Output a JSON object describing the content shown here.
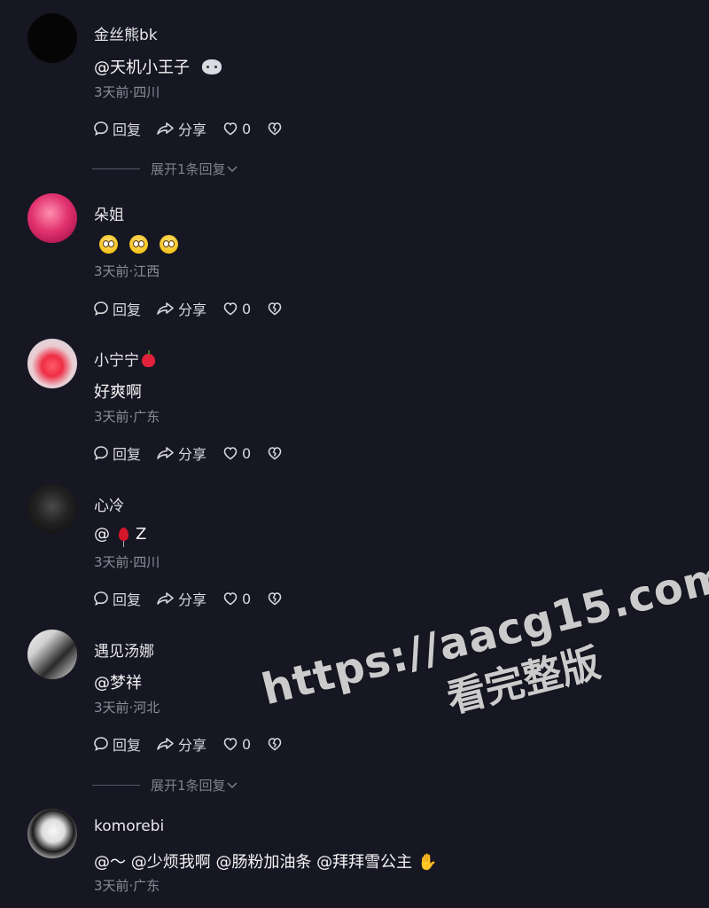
{
  "comments": [
    {
      "name": "金丝熊bk",
      "content": "@天机小王子",
      "meta": "3天前·四川",
      "reply": "回复",
      "share": "分享",
      "likes": "0",
      "expand": "展开1条回复"
    },
    {
      "name": "朵姐",
      "content": "",
      "meta": "3天前·江西",
      "reply": "回复",
      "share": "分享",
      "likes": "0"
    },
    {
      "name": "小宁宁",
      "content": "好爽啊",
      "meta": "3天前·广东",
      "reply": "回复",
      "share": "分享",
      "likes": "0"
    },
    {
      "name": "心冷",
      "content_prefix": "@",
      "content_suffix": "Z",
      "meta": "3天前·四川",
      "reply": "回复",
      "share": "分享",
      "likes": "0"
    },
    {
      "name": "遇见汤娜",
      "content": "@梦祥",
      "meta": "3天前·河北",
      "reply": "回复",
      "share": "分享",
      "likes": "0",
      "expand": "展开1条回复"
    },
    {
      "name": "komorebi",
      "content": "@～  @少烦我啊  @肠粉加油条  @拜拜雪公主",
      "meta": "3天前·广东"
    }
  ],
  "watermark": {
    "url": "https://aacg15.com",
    "sub": "看完整版"
  },
  "icons": {
    "reply": "comment-bubble-icon",
    "share": "share-arrow-icon",
    "like": "heart-icon",
    "dislike": "broken-heart-icon",
    "expand": "chevron-down-icon"
  }
}
